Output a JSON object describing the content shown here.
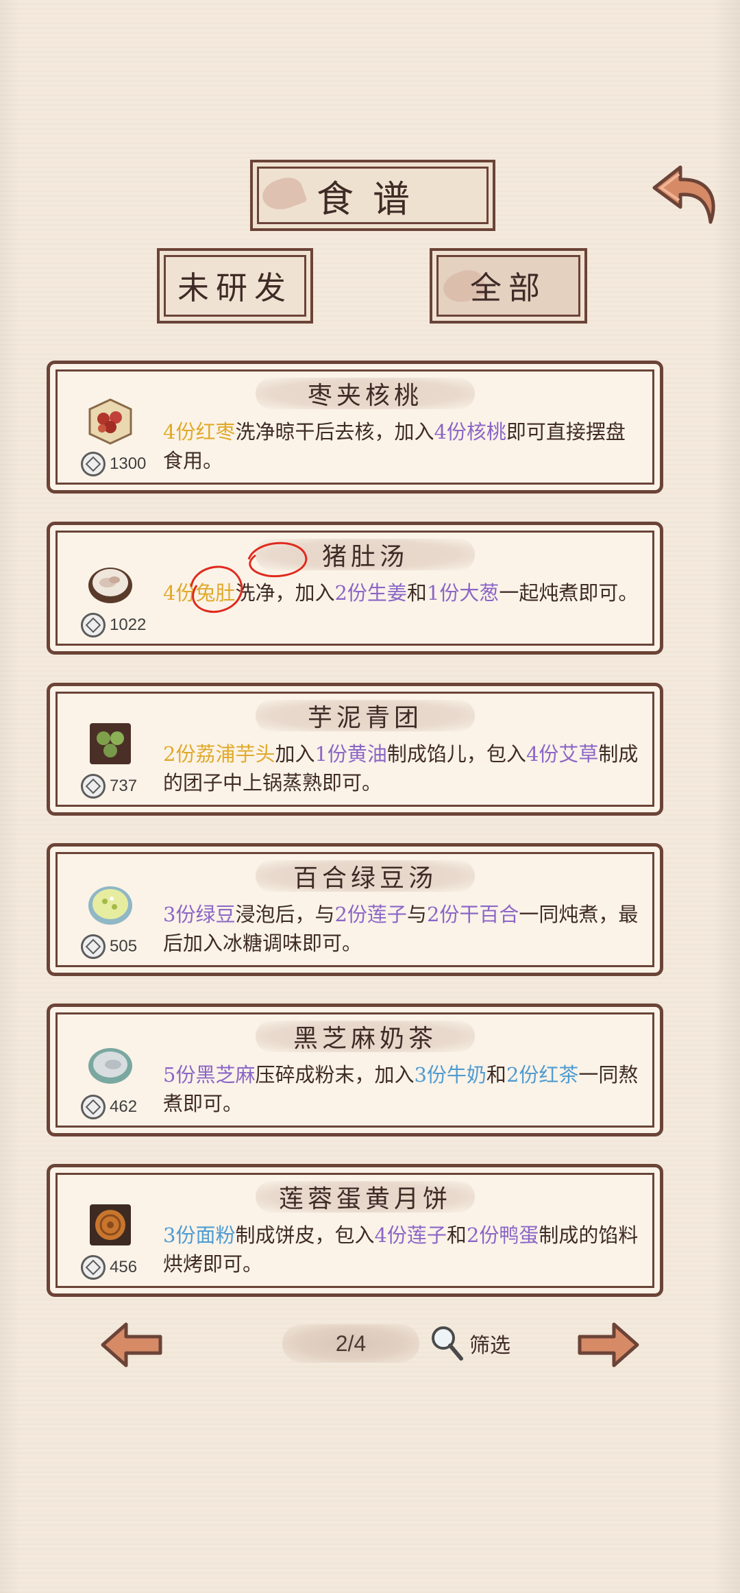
{
  "header": {
    "title": "食谱"
  },
  "tabs": [
    {
      "label": "未研发"
    },
    {
      "label": "全部"
    }
  ],
  "recipes": [
    {
      "name": "枣夹核桃",
      "price": "1300",
      "dish_icon": "jujube-walnut-plate-icon",
      "desc": [
        {
          "t": "4份红枣",
          "c": "y"
        },
        {
          "t": "洗净晾干后去核，加入"
        },
        {
          "t": "4份核桃",
          "c": "p"
        },
        {
          "t": "即可直接摆盘食用。"
        }
      ]
    },
    {
      "name": "猪肚汤",
      "price": "1022",
      "dish_icon": "pork-tripe-soup-pot-icon",
      "desc": [
        {
          "t": "4份兔肚",
          "c": "y"
        },
        {
          "t": "洗净，加入"
        },
        {
          "t": "2份生姜",
          "c": "p"
        },
        {
          "t": "和"
        },
        {
          "t": "1份大葱",
          "c": "p"
        },
        {
          "t": "一起炖煮即可。"
        }
      ]
    },
    {
      "name": "芋泥青团",
      "price": "737",
      "dish_icon": "green-rice-ball-plate-icon",
      "desc": [
        {
          "t": "2份荔浦芋头",
          "c": "y"
        },
        {
          "t": "加入"
        },
        {
          "t": "1份黄油",
          "c": "p"
        },
        {
          "t": "制成馅儿，包入"
        },
        {
          "t": "4份艾草",
          "c": "p"
        },
        {
          "t": "制成的团子中上锅蒸熟即可。"
        }
      ]
    },
    {
      "name": "百合绿豆汤",
      "price": "505",
      "dish_icon": "mung-bean-soup-bowl-icon",
      "desc": [
        {
          "t": "3份绿豆",
          "c": "p"
        },
        {
          "t": "浸泡后，与"
        },
        {
          "t": "2份莲子",
          "c": "p"
        },
        {
          "t": "与"
        },
        {
          "t": "2份干百合",
          "c": "p"
        },
        {
          "t": "一同炖煮，最后加入冰糖调味即可。"
        }
      ]
    },
    {
      "name": "黑芝麻奶茶",
      "price": "462",
      "dish_icon": "sesame-milk-tea-bowl-icon",
      "desc": [
        {
          "t": "5份黑芝麻",
          "c": "p"
        },
        {
          "t": "压碎成粉末，加入"
        },
        {
          "t": "3份牛奶",
          "c": "b"
        },
        {
          "t": "和"
        },
        {
          "t": "2份红茶",
          "c": "b"
        },
        {
          "t": "一同熬煮即可。"
        }
      ]
    },
    {
      "name": "莲蓉蛋黄月饼",
      "price": "456",
      "dish_icon": "mooncake-plate-icon",
      "desc": [
        {
          "t": "3份面粉",
          "c": "b"
        },
        {
          "t": "制成饼皮，包入"
        },
        {
          "t": "4份莲子",
          "c": "p"
        },
        {
          "t": "和"
        },
        {
          "t": "2份鸭蛋",
          "c": "p"
        },
        {
          "t": "制成的馅料烘烤即可。"
        }
      ]
    }
  ],
  "pager": {
    "page": "2/4",
    "filter_label": "筛选"
  },
  "colors": {
    "frame": "#6b4337",
    "highlight_yellow": "#e0a92a",
    "highlight_purple": "#8b66c6",
    "highlight_blue": "#4f9bd1",
    "annotation_red": "#e02a1e"
  }
}
